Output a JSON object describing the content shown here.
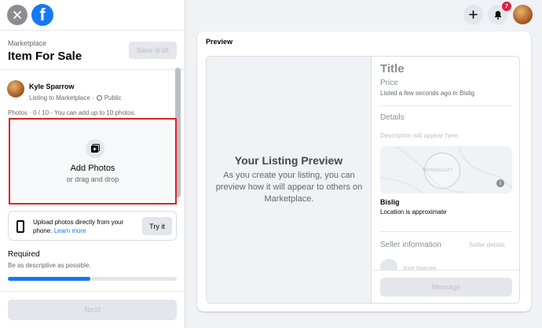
{
  "header": {
    "logo": "f",
    "notification_count": "7"
  },
  "sidebar": {
    "breadcrumb": "Marketplace",
    "title": "Item For Sale",
    "save_draft_label": "Save draft",
    "seller_name": "Kyle Sparrow",
    "listing_to": "Listing to Marketplace ·",
    "audience": "Public",
    "photos_count": "Photos · 0 / 10 - You can add up to 10 photos.",
    "add_photos_label": "Add Photos",
    "drag_drop_label": "or drag and drop",
    "upload_text": "Upload photos directly from your phone.",
    "learn_more": "Learn more",
    "try_it_label": "Try it",
    "required_title": "Required",
    "required_sub": "Be as descriptive as possible.",
    "progress_percent": 49,
    "next_label": "Next"
  },
  "preview": {
    "label": "Preview",
    "listing_title": "Your Listing Preview",
    "listing_desc": "As you create your listing, you can preview how it will appear to others on Marketplace.",
    "item_title": "Title",
    "price": "Price",
    "listed_time": "Listed a few seconds ago in Bislig",
    "details_heading": "Details",
    "description_placeholder": "Description will appear here.",
    "map_label": "MANDAGOY",
    "location_name": "Bislig",
    "location_approx": "Location is approximate",
    "seller_information": "Seller information",
    "seller_details": "Seller details",
    "seller_name": "Kyle Sparrow",
    "message_label": "Message"
  },
  "colors": {
    "accent": "#1877f2",
    "highlight_border": "#e02020",
    "badge": "#e41e3f"
  }
}
